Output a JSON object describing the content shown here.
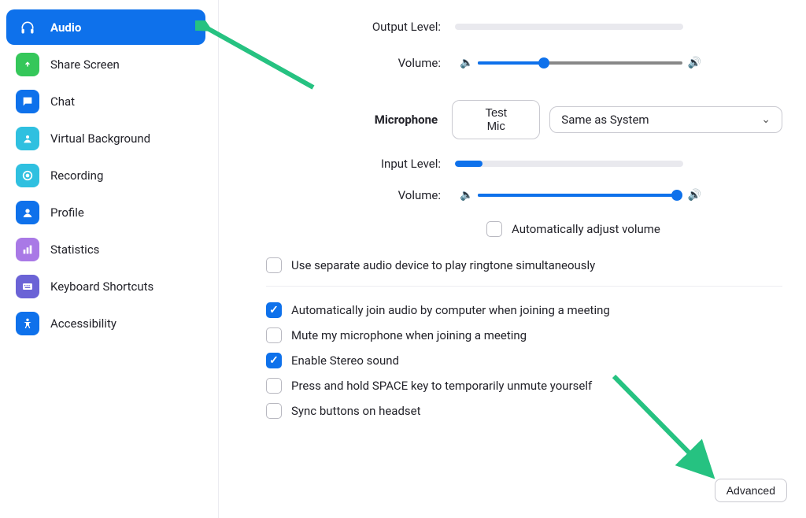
{
  "sidebar": {
    "items": [
      {
        "label": "Audio"
      },
      {
        "label": "Share Screen"
      },
      {
        "label": "Chat"
      },
      {
        "label": "Virtual Background"
      },
      {
        "label": "Recording"
      },
      {
        "label": "Profile"
      },
      {
        "label": "Statistics"
      },
      {
        "label": "Keyboard Shortcuts"
      },
      {
        "label": "Accessibility"
      }
    ]
  },
  "speaker": {
    "output_level_label": "Output Level:",
    "output_level_pct": 0,
    "volume_label": "Volume:",
    "volume_pct": 32
  },
  "mic": {
    "section_label": "Microphone",
    "test_button": "Test Mic",
    "device_selected": "Same as System",
    "input_level_label": "Input Level:",
    "input_level_pct": 12,
    "volume_label": "Volume:",
    "volume_pct": 97,
    "auto_adjust_label": "Automatically adjust volume",
    "auto_adjust_checked": false
  },
  "options": {
    "ringtone": {
      "label": "Use separate audio device to play ringtone simultaneously",
      "checked": false
    },
    "items": [
      {
        "label": "Automatically join audio by computer when joining a meeting",
        "checked": true
      },
      {
        "label": "Mute my microphone when joining a meeting",
        "checked": false
      },
      {
        "label": "Enable Stereo sound",
        "checked": true
      },
      {
        "label": "Press and hold SPACE key to temporarily unmute yourself",
        "checked": false
      },
      {
        "label": "Sync buttons on headset",
        "checked": false
      }
    ]
  },
  "advanced_label": "Advanced"
}
